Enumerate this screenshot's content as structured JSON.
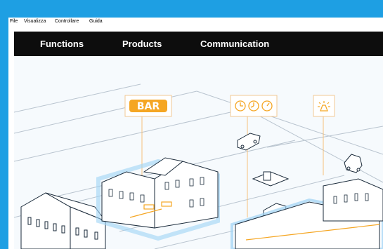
{
  "menubar": {
    "items": [
      "File",
      "Visualizza",
      "Controllare",
      "Guida"
    ]
  },
  "nav": {
    "items": [
      "Functions",
      "Products",
      "Communication"
    ]
  },
  "scene": {
    "badges": [
      {
        "name": "bar-badge",
        "label": "BAR",
        "icon": "bar-sign-icon"
      },
      {
        "name": "timer-badge",
        "label": "",
        "icon": "clock-icon"
      },
      {
        "name": "light-badge",
        "label": "",
        "icon": "light-bulb-icon"
      }
    ],
    "accent_color": "#f5a623",
    "outline_color": "#1a2a3a",
    "glow_color": "#9fd3f5"
  }
}
